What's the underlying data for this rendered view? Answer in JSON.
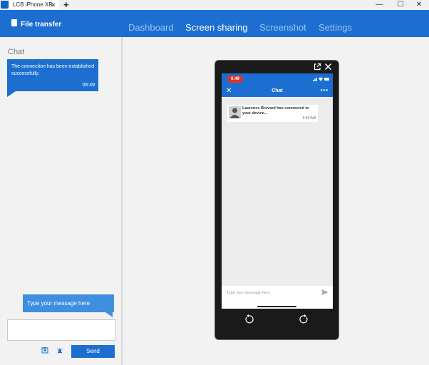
{
  "window": {
    "tab_title": "LCB iPhone XR",
    "new_tab": "+",
    "minimize": "—",
    "maximize": "☐",
    "close": "✕"
  },
  "header": {
    "file_transfer": "File transfer",
    "nav": [
      "Dashboard",
      "Screen sharing",
      "Screenshot",
      "Settings"
    ],
    "active_nav": "Screen sharing",
    "accent": "#1c6fd0"
  },
  "sidebar": {
    "heading": "Chat",
    "message": {
      "text": "The connection has been established successfully.",
      "time": "06:49"
    },
    "tooltip": "Type your message here",
    "message_value": "",
    "send_label": "Send",
    "tool_icons": [
      "screenshot-icon",
      "alert-icon"
    ]
  },
  "phone": {
    "status_time": "6:49",
    "chat_title": "Chat",
    "notification": {
      "text": "Laurence Brevard has connected to your device...",
      "time": "6:49 AM"
    },
    "compose_placeholder": "Type your message here",
    "top_icons": [
      "external-link-icon",
      "close-icon"
    ],
    "bottom_icons": [
      "rotate-left-icon",
      "rotate-right-icon"
    ]
  }
}
